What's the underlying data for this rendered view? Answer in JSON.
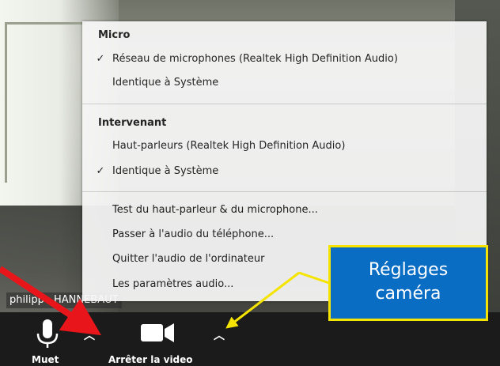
{
  "video": {
    "participant_name": "philippe HANNEBAUT"
  },
  "audio_menu": {
    "micro": {
      "heading": "Micro",
      "items": [
        {
          "label": "Réseau de microphones (Realtek High Definition Audio)",
          "checked": true
        },
        {
          "label": "Identique à Système",
          "checked": false
        }
      ]
    },
    "speaker": {
      "heading": "Intervenant",
      "items": [
        {
          "label": "Haut-parleurs (Realtek High Definition Audio)",
          "checked": false
        },
        {
          "label": "Identique à Système",
          "checked": true
        }
      ]
    },
    "actions": [
      "Test du haut-parleur & du microphone...",
      "Passer à l'audio du téléphone...",
      "Quitter l'audio de l'ordinateur",
      "Les paramètres audio..."
    ],
    "check_glyph": "✓"
  },
  "toolbar": {
    "mute_label": "Muet",
    "video_label": "Arrêter la video",
    "caret_glyph": "︿"
  },
  "callout": {
    "line1": "Réglages",
    "line2": "caméra"
  },
  "colors": {
    "callout_bg": "#0a6dc4",
    "callout_border": "#f5e400",
    "red_arrow": "#e8161b",
    "yellow_arrow": "#f5e400",
    "toolbar_bg": "#1b1b1b"
  }
}
